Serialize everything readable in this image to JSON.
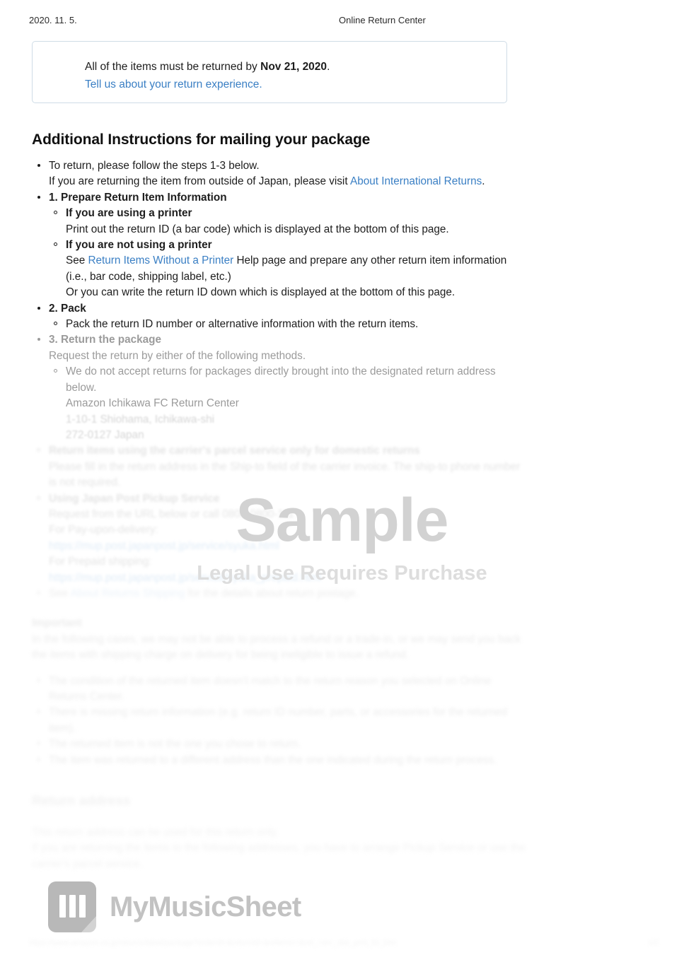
{
  "header": {
    "date": "2020. 11. 5.",
    "title": "Online Return Center"
  },
  "notice": {
    "text_before": "All of the items must be returned by ",
    "deadline": "Nov 21, 2020",
    "text_after": ".",
    "link": "Tell us about your return experience."
  },
  "heading": "Additional Instructions for mailing your package",
  "instructions": {
    "intro": {
      "line1": "To return, please follow the steps 1-3 below.",
      "line2_before": "If you are returning the item from outside of Japan, please visit ",
      "line2_link": "About International Returns",
      "line2_after": "."
    },
    "step1": {
      "title": "1. Prepare Return Item Information",
      "sub1_title": "If you are using a printer",
      "sub1_body": "Print out the return ID (a bar code) which is displayed at the bottom of this page.",
      "sub2_title": "If you are not using a printer",
      "sub2_before": "See ",
      "sub2_link": "Return Items Without a Printer",
      "sub2_after": " Help page and prepare any other return item information (i.e., bar code, shipping label, etc.)",
      "sub2_extra": "Or you can write the return ID down which is displayed at the bottom of this page."
    },
    "step2": {
      "title": "2. Pack",
      "sub1": "Pack the return ID number or alternative information with the return items."
    },
    "step3": {
      "title": "3. Return the package",
      "lead": "Request the return by either of the following methods.",
      "sub1": "We do not accept returns for packages directly brought into the designated return address below.",
      "address_name": "Amazon Ichikawa FC Return Center",
      "address_line1": "1-10-1 Shiohama, Ichikawa-shi",
      "address_line2": "272-0127 Japan",
      "method1_title": "Return items using the carrier's parcel service only for domestic returns",
      "method1_body1": "Please fill in the return address in the Ship-to field of the carrier invoice. The ship-to phone number is not required.",
      "method2_title": "Using Japan Post Pickup Service",
      "method2_body1": "Request from the URL below or call 0800-0800-111",
      "method2_label1": "For Pay-upon-delivery:",
      "method2_url1": "https://mup.post.japanpost.jp/service/syuka.html",
      "method2_label2": "For Prepaid shipping:",
      "method2_url2": "https://mup.post.japanpost.jp/service/syuka_prepaid.html",
      "method3_before": "See ",
      "method3_link": "About Returns Shipping",
      "method3_after": " for the details about return postage."
    },
    "important": {
      "title": "Important",
      "lead": "In the following cases, we may not be able to process a refund or a trade-in, or we may send you back the items with shipping charge on delivery for being ineligible to issue a refund.",
      "items": [
        "The condition of the returned item doesn't match to the return reason you selected on Online Returns Center.",
        "There is missing return information (e.g. return ID number, parts, or accessories for the returned item).",
        "The returned item is not the one you chose to return.",
        "The item was returned to a different address than the one indicated during the return process."
      ]
    },
    "return_address": {
      "title": "Return address",
      "line1": "This return address can be used for this return only.",
      "line2": "If you are returning the items to the following addresses, you have to arrange Pickup Service or use the carrier's parcel service."
    }
  },
  "watermark": {
    "main": "Sample",
    "sub": "Legal Use Requires Purchase"
  },
  "logo": {
    "text": "MyMusicSheet"
  },
  "footer": {
    "url": "https://www.amazon.co.jp/returns/label/package?orderId=&returnId=&referrer=&ref_=orc_dsk_prnt_lbl_btm",
    "page": "1/2"
  }
}
